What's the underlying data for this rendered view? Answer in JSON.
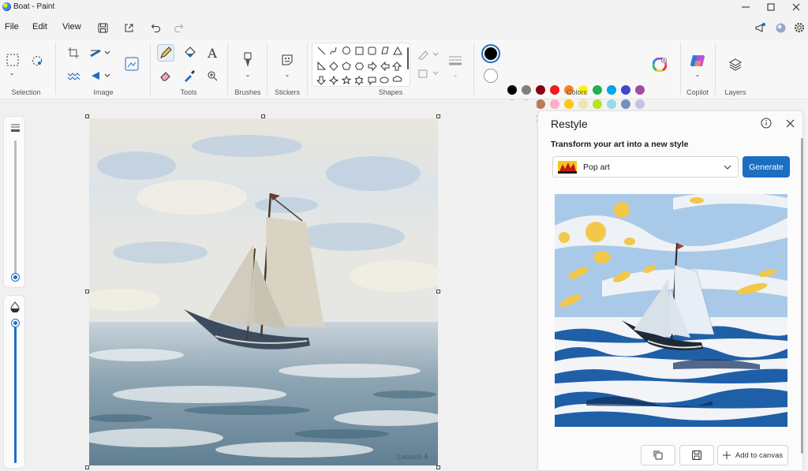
{
  "window": {
    "title": "Boat - Paint",
    "min_icon": "minimize-icon",
    "max_icon": "maximize-icon",
    "close_icon": "close-icon"
  },
  "menu": {
    "items": [
      "File",
      "Edit",
      "View"
    ],
    "icons": [
      "save-icon",
      "share-icon",
      "undo-icon",
      "redo-icon"
    ]
  },
  "ribbon": {
    "groups": {
      "selection": "Selection",
      "image": "Image",
      "tools": "Tools",
      "brushes": "Brushes",
      "stickers": "Stickers",
      "shapes": "Shapes",
      "colors": "Colors",
      "copilot": "Copilot",
      "layers": "Layers"
    },
    "shape_icons": [
      "line",
      "curve",
      "oval",
      "rectangle",
      "rounded-rectangle",
      "polygon",
      "triangle",
      "right-triangle",
      "diamond",
      "pentagon",
      "hexagon",
      "right-arrow",
      "left-arrow",
      "up-arrow",
      "down-arrow",
      "four-point-star",
      "five-point-star",
      "six-point-star",
      "rounded-callout",
      "oval-callout",
      "cloud-callout"
    ],
    "primary_color": "#000000",
    "secondary_color": "#ffffff",
    "palette_row1": [
      "#000000",
      "#7f7f7f",
      "#880015",
      "#ed1c24",
      "#ff7f27",
      "#fff200",
      "#22b14c",
      "#00a2e8",
      "#3f48cc",
      "#a349a4"
    ],
    "palette_row2": [
      "#ffffff",
      "#c3c3c3",
      "#b97a57",
      "#ffaec9",
      "#ffc90e",
      "#efe4b0",
      "#b5e61d",
      "#99d9ea",
      "#7092be",
      "#c8bfe7"
    ]
  },
  "restyle": {
    "title": "Restyle",
    "subtitle": "Transform your art into a new style",
    "style": "Pop art",
    "generate": "Generate",
    "add_to_canvas": "Add to canvas"
  },
  "canvas": {
    "signature": "Leonel 4"
  }
}
